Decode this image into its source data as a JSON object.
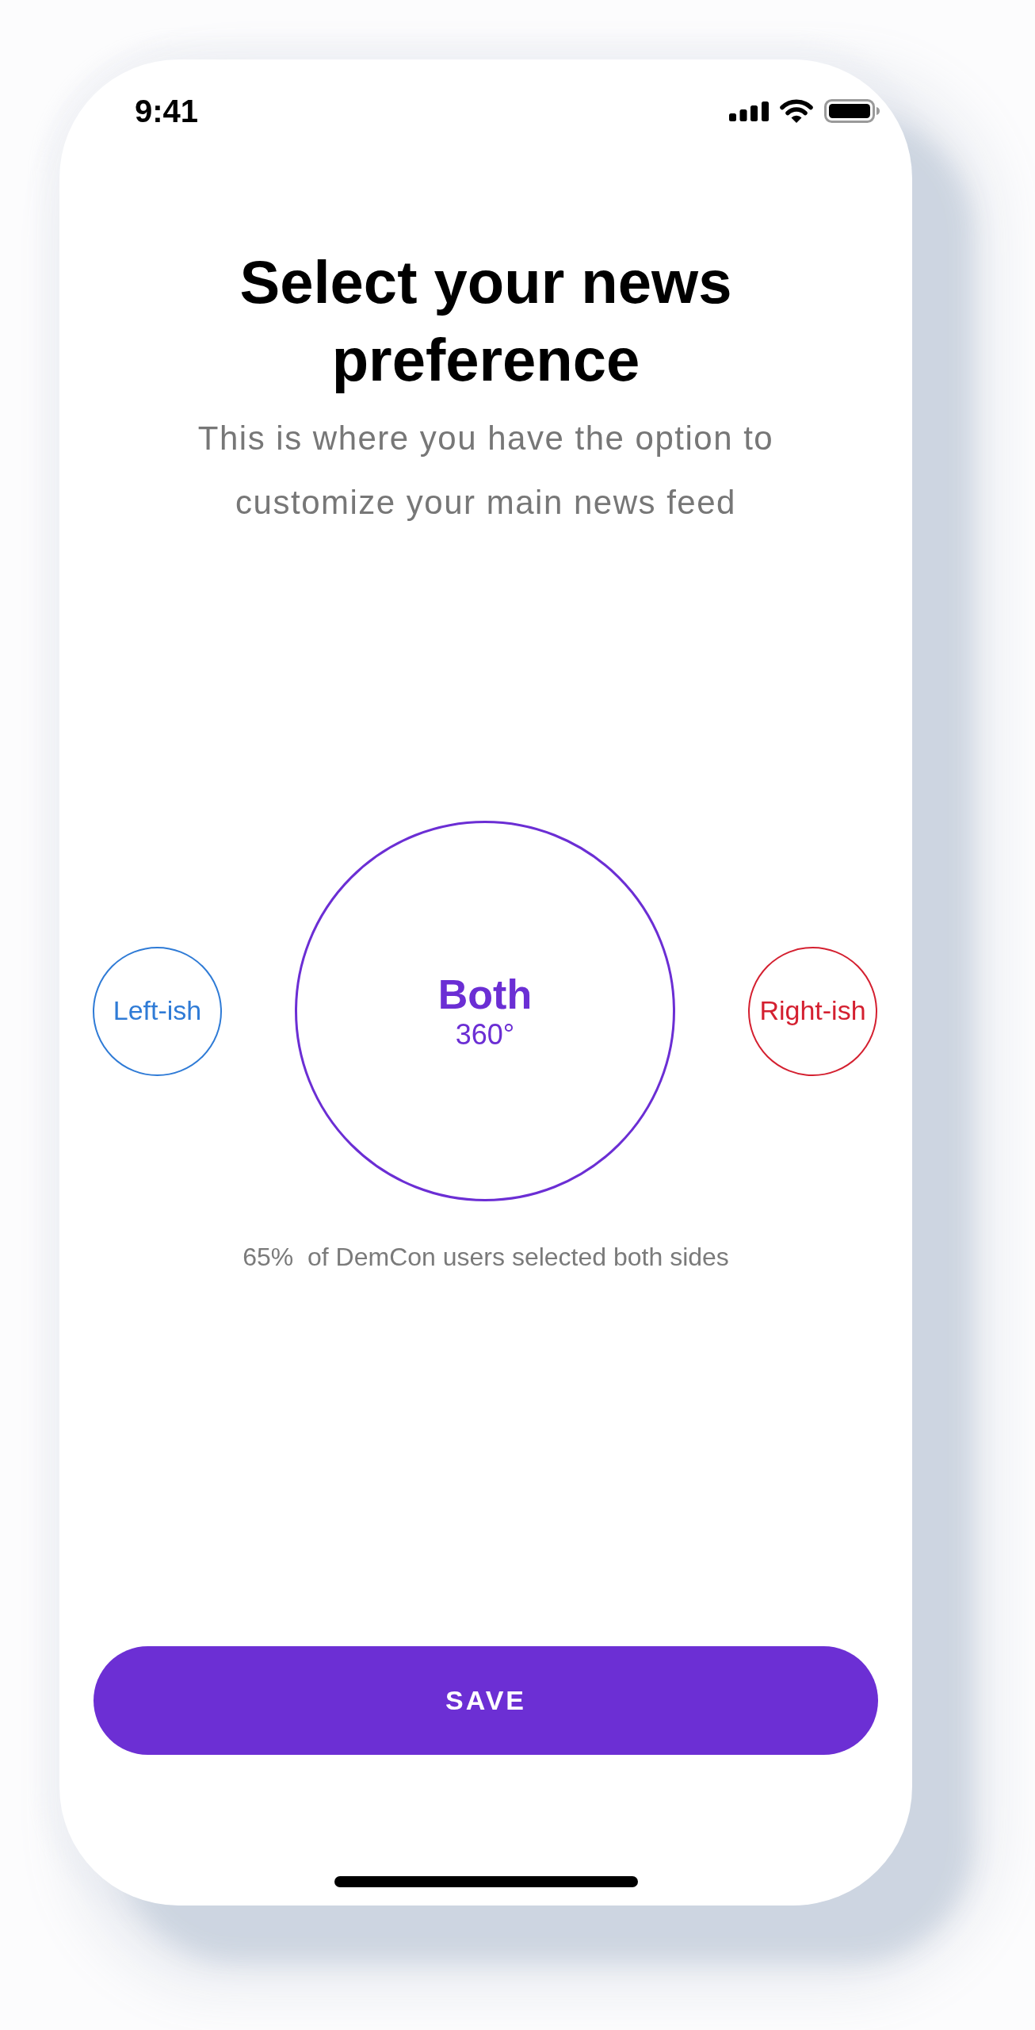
{
  "status_bar": {
    "time": "9:41"
  },
  "header": {
    "title": "Select your news preference",
    "subtitle": "This is where you have the option to customize your main news feed"
  },
  "options": [
    {
      "label": "Left-ish",
      "color": "#2f7bd6",
      "selected": false
    },
    {
      "label": "Both",
      "sublabel": "360°",
      "color": "#6b2ed4",
      "selected": true
    },
    {
      "label": "Right-ish",
      "color": "#d42030",
      "selected": false
    }
  ],
  "stat": "65%  of DemCon users selected both sides",
  "save_button": {
    "label": "SAVE"
  }
}
